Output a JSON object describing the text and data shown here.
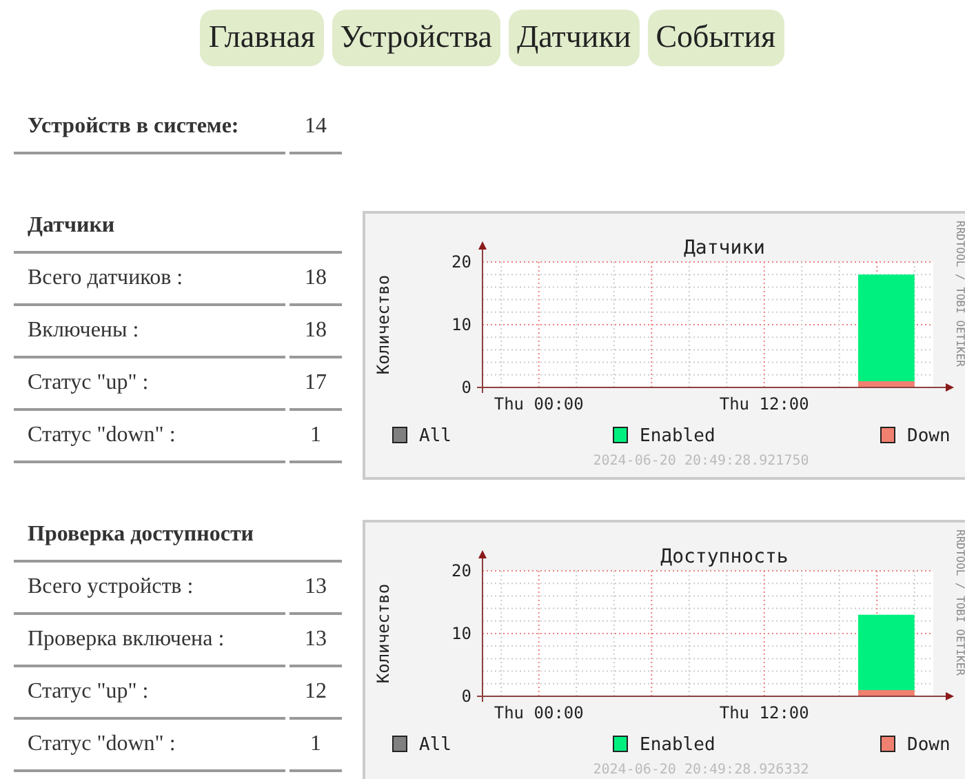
{
  "nav": [
    {
      "label": "Главная"
    },
    {
      "label": "Устройства"
    },
    {
      "label": "Датчики"
    },
    {
      "label": "События"
    }
  ],
  "summary": {
    "label": "Устройств в системе:",
    "value": "14"
  },
  "sections": [
    {
      "title": "Датчики",
      "rows": [
        {
          "label": "Всего датчиков :",
          "value": "18"
        },
        {
          "label": "Включены :",
          "value": "18"
        },
        {
          "label": "Статус \"up\" :",
          "value": "17"
        },
        {
          "label": "Статус \"down\" :",
          "value": "1"
        }
      ],
      "chart": {
        "watermark": "RRDTOOL / TOBI OETIKER",
        "timestamp": "2024-06-20 20:49:28.921750",
        "chart_data": {
          "type": "area",
          "title": "Датчики",
          "ylabel": "Количество",
          "grid": true,
          "legend": "bottom",
          "stacked": true,
          "categories": [
            null,
            null,
            null,
            "Thu 00:00",
            null,
            null,
            null,
            null,
            null,
            null,
            null,
            null,
            null,
            null,
            null,
            "Thu 12:00",
            null,
            null,
            null,
            null,
            null,
            null,
            null,
            null
          ],
          "ylim": [
            0,
            20
          ],
          "yticks": [
            0,
            10,
            20
          ],
          "series": [
            {
              "name": "All",
              "color": "#808080",
              "values": [
                null,
                null,
                null,
                null,
                null,
                null,
                null,
                null,
                null,
                null,
                null,
                null,
                null,
                null,
                null,
                null,
                null,
                null,
                null,
                null,
                null,
                null,
                null,
                null
              ]
            },
            {
              "name": "Down",
              "color": "#f08070",
              "values": [
                null,
                null,
                null,
                null,
                null,
                null,
                null,
                null,
                null,
                null,
                null,
                null,
                null,
                null,
                null,
                null,
                null,
                null,
                null,
                null,
                1,
                1,
                1,
                1
              ]
            },
            {
              "name": "Enabled",
              "color": "#00f080",
              "values": [
                null,
                null,
                null,
                null,
                null,
                null,
                null,
                null,
                null,
                null,
                null,
                null,
                null,
                null,
                null,
                null,
                null,
                null,
                null,
                null,
                17,
                17,
                17,
                17
              ]
            }
          ]
        }
      }
    },
    {
      "title": "Проверка доступности",
      "rows": [
        {
          "label": "Всего устройств :",
          "value": "13"
        },
        {
          "label": "Проверка включена :",
          "value": "13"
        },
        {
          "label": "Статус \"up\" :",
          "value": "12"
        },
        {
          "label": "Статус \"down\" :",
          "value": "1"
        }
      ],
      "chart": {
        "watermark": "RRDTOOL / TOBI OETIKER",
        "timestamp": "2024-06-20 20:49:28.926332",
        "chart_data": {
          "type": "area",
          "title": "Доступность",
          "ylabel": "Количество",
          "grid": true,
          "legend": "bottom",
          "stacked": true,
          "categories": [
            null,
            null,
            null,
            "Thu 00:00",
            null,
            null,
            null,
            null,
            null,
            null,
            null,
            null,
            null,
            null,
            null,
            "Thu 12:00",
            null,
            null,
            null,
            null,
            null,
            null,
            null,
            null
          ],
          "ylim": [
            0,
            20
          ],
          "yticks": [
            0,
            10,
            20
          ],
          "series": [
            {
              "name": "All",
              "color": "#808080",
              "values": [
                null,
                null,
                null,
                null,
                null,
                null,
                null,
                null,
                null,
                null,
                null,
                null,
                null,
                null,
                null,
                null,
                null,
                null,
                null,
                null,
                null,
                null,
                null,
                null
              ]
            },
            {
              "name": "Down",
              "color": "#f08070",
              "values": [
                null,
                null,
                null,
                null,
                null,
                null,
                null,
                null,
                null,
                null,
                null,
                null,
                null,
                null,
                null,
                null,
                null,
                null,
                null,
                null,
                1,
                1,
                1,
                1
              ]
            },
            {
              "name": "Enabled",
              "color": "#00f080",
              "values": [
                null,
                null,
                null,
                null,
                null,
                null,
                null,
                null,
                null,
                null,
                null,
                null,
                null,
                null,
                null,
                null,
                null,
                null,
                null,
                null,
                12,
                12,
                12,
                12
              ]
            }
          ]
        }
      }
    }
  ]
}
